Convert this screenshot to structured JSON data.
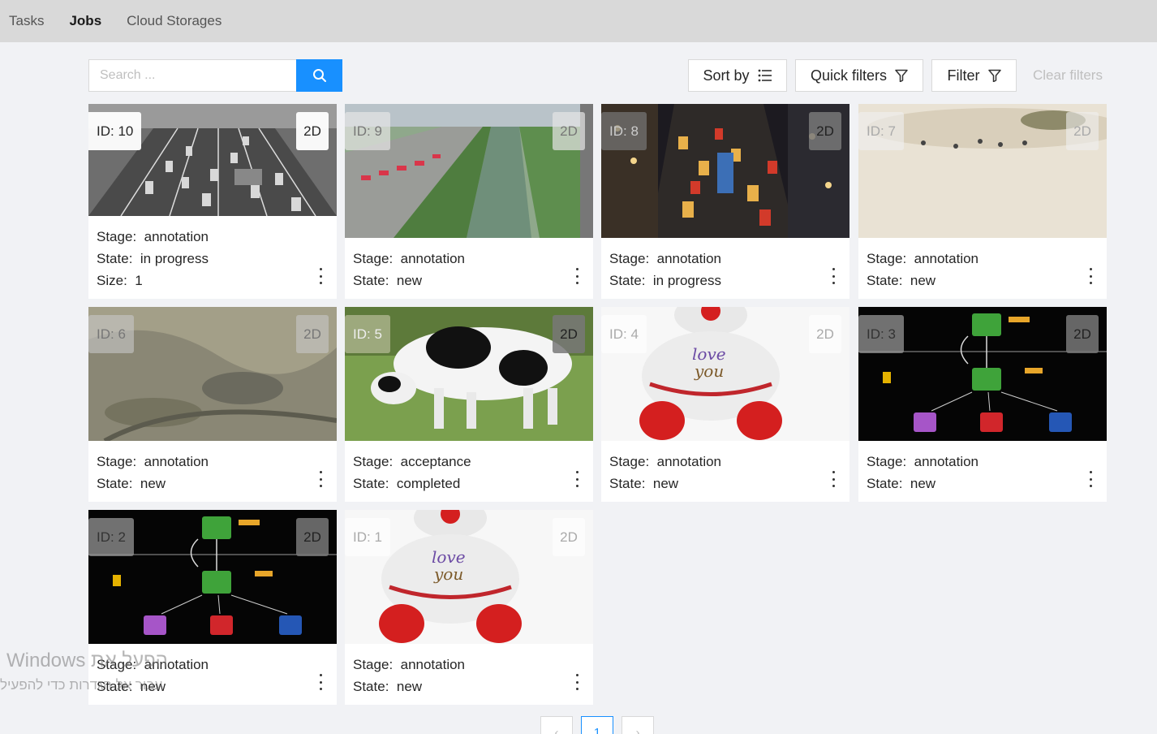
{
  "nav": {
    "tabs": [
      "Tasks",
      "Jobs",
      "Cloud Storages"
    ],
    "active": "Jobs"
  },
  "search": {
    "placeholder": "Search ...",
    "value": ""
  },
  "filters": {
    "sort_by": "Sort by",
    "quick_filters": "Quick filters",
    "filter": "Filter",
    "clear_filters": "Clear filters"
  },
  "labels": {
    "stage": "Stage",
    "state": "State",
    "size": "Size"
  },
  "jobs": [
    {
      "id_label": "ID: 10",
      "dim": "2D",
      "stage": "annotation",
      "state": "in progress",
      "size": "1"
    },
    {
      "id_label": "ID: 9",
      "dim": "2D",
      "stage": "annotation",
      "state": "new"
    },
    {
      "id_label": "ID: 8",
      "dim": "2D",
      "stage": "annotation",
      "state": "in progress"
    },
    {
      "id_label": "ID: 7",
      "dim": "2D",
      "stage": "annotation",
      "state": "new"
    },
    {
      "id_label": "ID: 6",
      "dim": "2D",
      "stage": "annotation",
      "state": "new"
    },
    {
      "id_label": "ID: 5",
      "dim": "2D",
      "stage": "acceptance",
      "state": "completed"
    },
    {
      "id_label": "ID: 4",
      "dim": "2D",
      "stage": "annotation",
      "state": "new"
    },
    {
      "id_label": "ID: 3",
      "dim": "2D",
      "stage": "annotation",
      "state": "new"
    },
    {
      "id_label": "ID: 2",
      "dim": "2D",
      "stage": "annotation",
      "state": "new"
    },
    {
      "id_label": "ID: 1",
      "dim": "2D",
      "stage": "annotation",
      "state": "new"
    }
  ],
  "thumb_text": {
    "love": "love",
    "you": "you"
  },
  "pagination": {
    "prev": "‹",
    "current": "1",
    "next": "›"
  },
  "os_watermark": {
    "line1": "Windows הפעל את",
    "line2": "עבור אל הגדרות כדי להפעיל"
  },
  "colors": {
    "accent": "#1890ff",
    "nav_bg": "#d9d9d9",
    "page_bg": "#f1f2f5"
  }
}
